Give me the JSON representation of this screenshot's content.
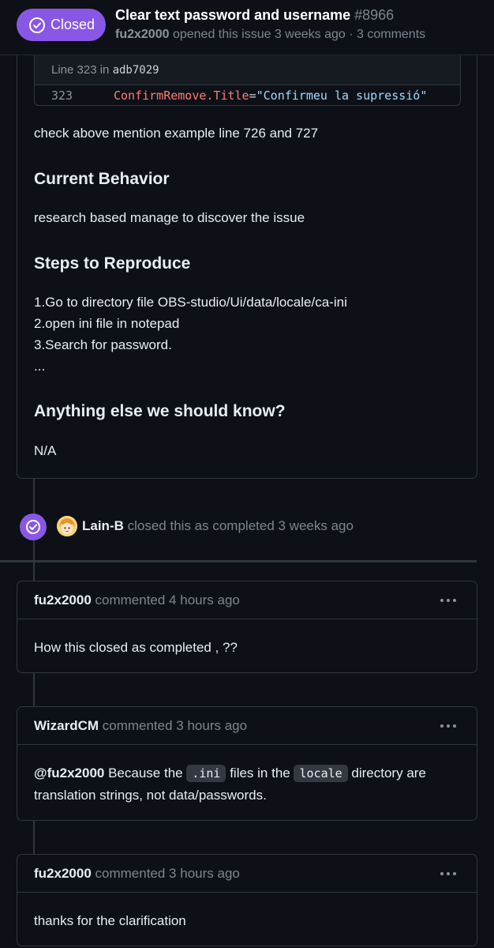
{
  "header": {
    "state": "Closed",
    "title": "Clear text password and username",
    "number": "#8966",
    "author": "fu2x2000",
    "opened_text": "opened this issue 3 weeks ago",
    "separator": "·",
    "comments": "3 comments"
  },
  "code_embed": {
    "line_prefix": "Line 323 in",
    "sha": "adb7029",
    "line_number": "323",
    "key": "ConfirmRemove.Title",
    "eq": "=",
    "value": "\"Confirmeu la supressió\""
  },
  "body": {
    "intro": "check above mention example line 726 and 727",
    "h_current": "Current Behavior",
    "current_text": "research based manage to discover the issue",
    "h_steps": "Steps to Reproduce",
    "step1": "1.Go to directory file OBS-studio/Ui/data/locale/ca-ini",
    "step2": "2.open ini file in notepad",
    "step3": "3.Search for password.",
    "step4": "...",
    "h_else": "Anything else we should know?",
    "else_text": "N/A"
  },
  "event": {
    "actor": "Lain-B",
    "text": "closed this as completed 3 weeks ago"
  },
  "comments": [
    {
      "author": "fu2x2000",
      "meta": "commented 4 hours ago",
      "body": "How this closed as completed , ??"
    },
    {
      "author": "WizardCM",
      "meta": "commented 3 hours ago",
      "body_mention": "@fu2x2000",
      "body_a": "Because the",
      "code1": ".ini",
      "body_b": "files in the",
      "code2": "locale",
      "body_c": "directory are translation strings, not data/passwords."
    },
    {
      "author": "fu2x2000",
      "meta": "commented 3 hours ago",
      "body": "thanks for the clarification"
    }
  ],
  "colors": {
    "closed_purple": "#8957e5",
    "background": "#0d1117",
    "border": "#30363d"
  }
}
